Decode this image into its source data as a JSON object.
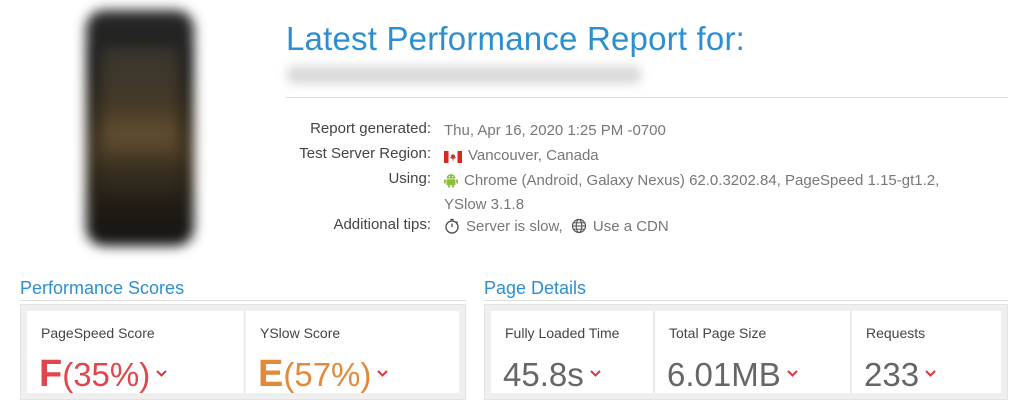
{
  "header": {
    "title": "Latest Performance Report for:"
  },
  "info": {
    "rows": [
      {
        "label": "Report generated:",
        "value": "Thu, Apr 16, 2020 1:25 PM -0700"
      },
      {
        "label": "Test Server Region:",
        "value": "Vancouver, Canada",
        "icon": "canada-flag-icon"
      },
      {
        "label": "Using:",
        "value": "Chrome (Android, Galaxy Nexus) 62.0.3202.84, PageSpeed 1.15-gt1.2,",
        "value2": "YSlow 3.1.8",
        "icon": "android-icon"
      },
      {
        "label": "Additional tips:",
        "tip1": "Server is slow,",
        "tip2": "Use a CDN",
        "icon1": "stopwatch-icon",
        "icon2": "globe-icon"
      }
    ]
  },
  "performance": {
    "title": "Performance Scores",
    "pagespeed": {
      "label": "PageSpeed Score",
      "grade": "F",
      "percent": "(35%)",
      "color": "#e0474c"
    },
    "yslow": {
      "label": "YSlow Score",
      "grade": "E",
      "percent": "(57%)",
      "color": "#e28a3a"
    }
  },
  "details": {
    "title": "Page Details",
    "load_time": {
      "label": "Fully Loaded Time",
      "value": "45.8s"
    },
    "page_size": {
      "label": "Total Page Size",
      "value": "6.01MB"
    },
    "requests": {
      "label": "Requests",
      "value": "233"
    }
  },
  "colors": {
    "accent": "#2b8fd1",
    "chevron": "#d9363e"
  }
}
